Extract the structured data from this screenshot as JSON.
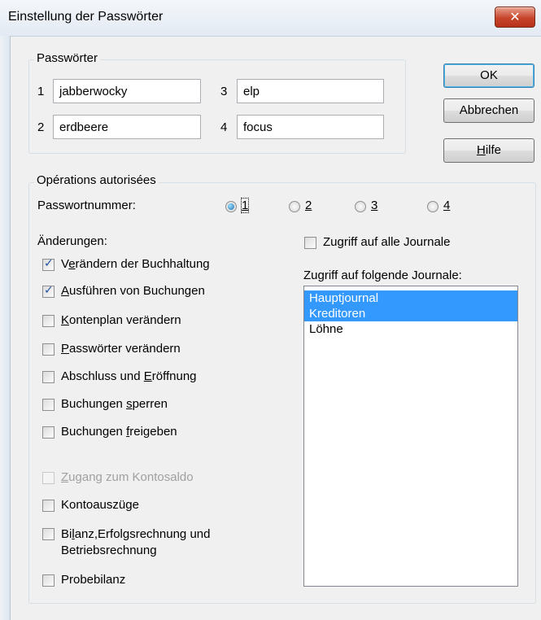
{
  "window": {
    "title": "Einstellung der Passwörter",
    "close_glyph": "✕"
  },
  "passwords": {
    "legend": "Passwörter",
    "entries": [
      {
        "num": "1",
        "value": "jabberwocky"
      },
      {
        "num": "2",
        "value": "erdbeere"
      },
      {
        "num": "3",
        "value": "elp"
      },
      {
        "num": "4",
        "value": "focus"
      }
    ]
  },
  "buttons": {
    "ok": "OK",
    "cancel": "Abbrechen",
    "help_mnemonic": "H",
    "help_rest": "ilfe"
  },
  "operations": {
    "legend": "Opérations autorisées",
    "password_number_label": "Passwortnummer:",
    "radios": [
      {
        "label": "1",
        "checked": true
      },
      {
        "label": "2",
        "checked": false
      },
      {
        "label": "3",
        "checked": false
      },
      {
        "label": "4",
        "checked": false
      }
    ],
    "changes_label": "Änderungen:",
    "checkboxes": [
      {
        "pre": "V",
        "mn": "e",
        "post": "rändern der Buchhaltung",
        "checked": true,
        "disabled": false
      },
      {
        "pre": "",
        "mn": "A",
        "post": "usführen von Buchungen",
        "checked": true,
        "disabled": false
      },
      {
        "pre": "",
        "mn": "K",
        "post": "ontenplan verändern",
        "checked": false,
        "disabled": false
      },
      {
        "pre": "",
        "mn": "P",
        "post": "asswörter verändern",
        "checked": false,
        "disabled": false
      },
      {
        "pre": "Abschluss und ",
        "mn": "E",
        "post": "röffnung",
        "checked": false,
        "disabled": false
      },
      {
        "pre": "Buchungen ",
        "mn": "s",
        "post": "perren",
        "checked": false,
        "disabled": false
      },
      {
        "pre": "Buchungen ",
        "mn": "f",
        "post": "reigeben",
        "checked": false,
        "disabled": false
      },
      {
        "pre": "",
        "mn": "Z",
        "post": "ugang zum Kontosaldo",
        "checked": false,
        "disabled": true
      },
      {
        "pre": "Kontoauszüge",
        "mn": "",
        "post": "",
        "checked": false,
        "disabled": false
      },
      {
        "pre": "Bi",
        "mn": "l",
        "post": "anz,Erfolgsrechnung und",
        "line2": "Betriebsrechnung",
        "checked": false,
        "disabled": false
      },
      {
        "pre": "Probebilanz",
        "mn": "",
        "post": "",
        "checked": false,
        "disabled": false
      }
    ],
    "all_journals_label": "Zugriff auf alle Journale",
    "all_journals_checked": false,
    "journals_label": "Zugriff auf folgende Journale:",
    "journals": [
      {
        "label": "Hauptjournal",
        "selected": true
      },
      {
        "label": "Kreditoren",
        "selected": true
      },
      {
        "label": "Löhne",
        "selected": false
      }
    ]
  }
}
